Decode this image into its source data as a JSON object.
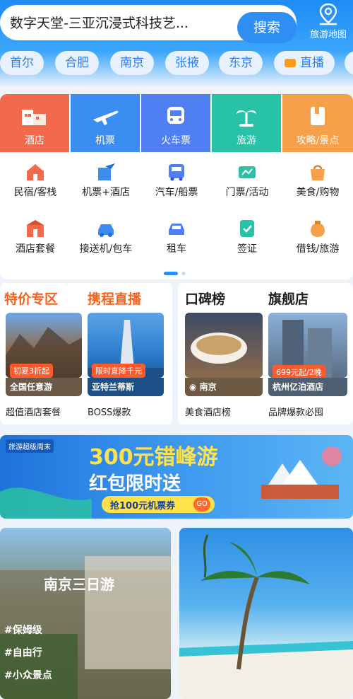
{
  "search": {
    "text": "数字天堂-三亚沉浸式科技艺...",
    "button": "搜索",
    "map_label": "旅游地图"
  },
  "cities": [
    "首尔",
    "合肥",
    "南京",
    "张掖",
    "东京",
    "直播"
  ],
  "primary": [
    {
      "label": "酒店",
      "icon": "hotel-icon",
      "color": "#f26a4b"
    },
    {
      "label": "机票",
      "icon": "plane-icon",
      "color": "#3b8df2"
    },
    {
      "label": "火车票",
      "icon": "train-icon",
      "color": "#4f7ff2"
    },
    {
      "label": "旅游",
      "icon": "palm-icon",
      "color": "#28c3a6"
    },
    {
      "label": "攻略/景点",
      "icon": "guide-icon",
      "color": "#f7a04a"
    }
  ],
  "grid": [
    {
      "label": "民宿/客栈",
      "icon": "homestay-icon"
    },
    {
      "label": "机票+酒店",
      "icon": "flight-hotel-icon"
    },
    {
      "label": "汽车/船票",
      "icon": "bus-icon"
    },
    {
      "label": "门票/活动",
      "icon": "ticket-icon"
    },
    {
      "label": "美食/购物",
      "icon": "food-icon"
    },
    {
      "label": "酒店套餐",
      "icon": "hotel-package-icon"
    },
    {
      "label": "接送机/包车",
      "icon": "car-icon"
    },
    {
      "label": "租车",
      "icon": "rental-car-icon"
    },
    {
      "label": "签证",
      "icon": "visa-icon"
    },
    {
      "label": "借钱/旅游",
      "icon": "money-bag-icon"
    }
  ],
  "promo": {
    "titles": [
      "特价专区",
      "携程直播",
      "口碑榜",
      "旗舰店"
    ],
    "tiles": [
      {
        "tag": "初夏3折起",
        "name": "全国任意游",
        "sub": "超值酒店套餐"
      },
      {
        "tag": "限时直降千元",
        "name": "亚特兰蒂斯",
        "sub": "BOSS爆款"
      },
      {
        "tag": "",
        "name": "南京",
        "sub": "美食酒店榜"
      },
      {
        "tag": "699元起/2晚",
        "name": "杭州亿泊酒店",
        "sub": "品牌爆款必囤"
      }
    ]
  },
  "banner": {
    "badge": "旅游超级周末",
    "title": "300元错峰游",
    "subtitle": "红包限时送",
    "coupon": "抢100元机票券",
    "go": "GO"
  },
  "bottom": {
    "left_title": "南京三日游",
    "left_notes": [
      "#保姆级",
      "#自由行",
      "#小众景点"
    ]
  },
  "colors": {
    "brand": "#2f8ef4",
    "promo_orange": "#f5641e"
  }
}
